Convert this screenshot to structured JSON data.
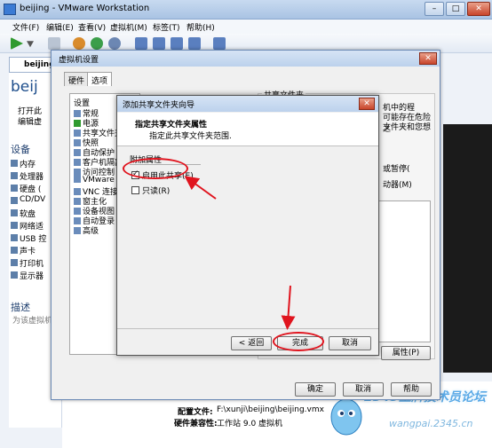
{
  "window": {
    "title": "beijing - VMware Workstation",
    "min": "–",
    "max": "□",
    "close": "✕"
  },
  "menu": [
    "文件(F)",
    "编辑(E)",
    "查看(V)",
    "虚拟机(M)",
    "标签(T)",
    "帮助(H)"
  ],
  "vm_tab": "beijing",
  "left": {
    "vm_name": "beij",
    "links": [
      "打开此",
      "编辑虚"
    ],
    "devices_title": "设备",
    "devices": [
      "内存",
      "处理器",
      "硬盘 (",
      "CD/DV",
      "软盘",
      "网络适",
      "USB 控",
      "声卡",
      "打印机",
      "显示器"
    ],
    "desc_title": "描述",
    "desc_text": "为该虚拟机"
  },
  "settings": {
    "title": "虚拟机设置",
    "tabs": [
      "硬件",
      "选项"
    ],
    "list_header": "设置",
    "items": [
      "常规",
      "电源",
      "共享文件夹",
      "快照",
      "自动保护",
      "客户机隔离",
      "访问控制",
      "VMware Tools",
      "VNC 连接",
      "窗主化",
      "设备视图",
      "自动登录",
      "高级"
    ],
    "right_header": "共享文件夹",
    "right_lines": [
      "机中的程",
      "可能存在危险之",
      "文件夹和您想",
      "",
      "或暂停(",
      "动器(M)"
    ],
    "properties_btn": "属性(P)",
    "ok": "确定",
    "cancel": "取消",
    "help": "帮助"
  },
  "wizard": {
    "title": "添加共享文件夹向导",
    "close": "✕",
    "heading": "指定共享文件夹属性",
    "subheading": "指定此共享文件夹范围.",
    "group_label": "附加属性",
    "enable_label": "启用此共享(E)",
    "readonly_label": "只读(R)",
    "back": "< 返回",
    "finish": "完成",
    "cancel": "取消"
  },
  "info": {
    "config_label": "配置文件:",
    "config_value": "F:\\xunji\\beijing\\beijing.vmx",
    "compat_label": "硬件兼容性:",
    "compat_value": "工作站 9.0 虚拟机"
  },
  "watermark": {
    "text": "2345王牌技术员论坛",
    "url": "wangpai.2345.cn"
  },
  "colors": {
    "annotation": "#e0141e",
    "accent": "#3b7bd4"
  }
}
